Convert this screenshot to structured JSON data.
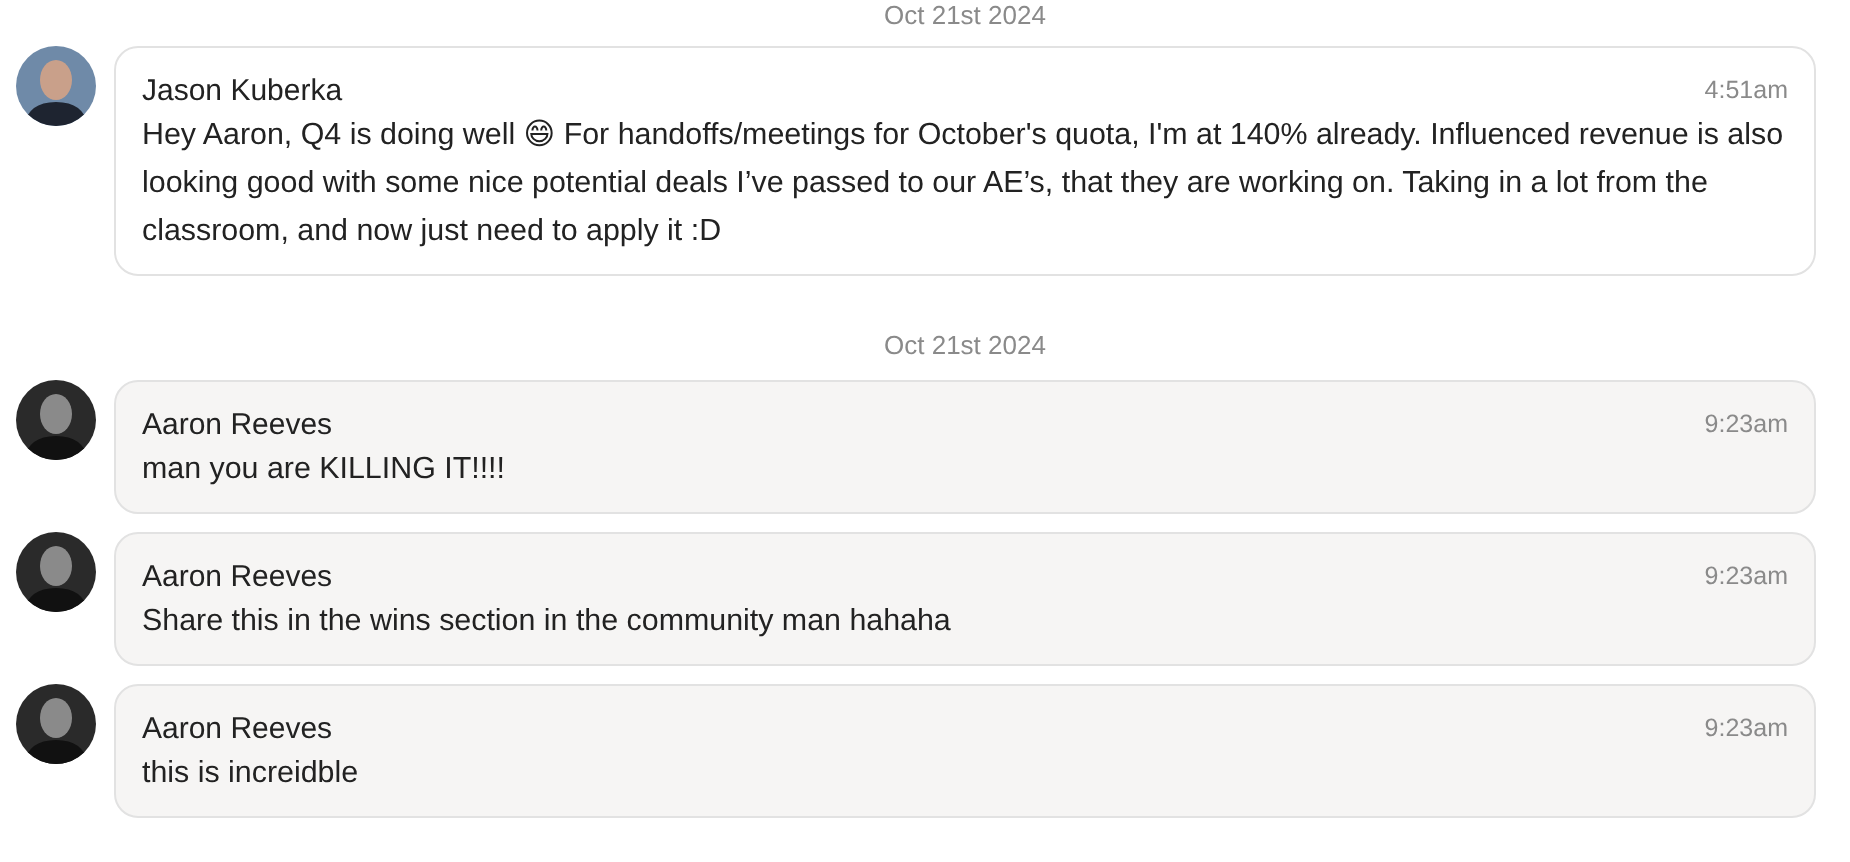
{
  "messages": [
    {
      "kind": "date",
      "text": "Oct 21st 2024"
    },
    {
      "kind": "other_message",
      "author": "Jason Kuberka",
      "time": "4:51am",
      "text": "Hey Aaron, Q4 is doing well 😄 For handoffs/meetings for October's quota, I'm at 140% already. Influenced revenue is also looking good with some nice potential deals I’ve passed to our AE’s, that they are working on. Taking in a lot from the classroom, and now just need to apply it :D"
    },
    {
      "kind": "date",
      "text": "Oct 21st 2024"
    },
    {
      "kind": "own_message",
      "author": "Aaron Reeves",
      "time": "9:23am",
      "text": "man you are KILLING IT!!!!"
    },
    {
      "kind": "own_message",
      "author": "Aaron Reeves",
      "time": "9:23am",
      "text": "Share this in the wins section in the community man hahaha"
    },
    {
      "kind": "own_message",
      "author": "Aaron Reeves",
      "time": "9:23am",
      "text": "this is increidble"
    }
  ]
}
